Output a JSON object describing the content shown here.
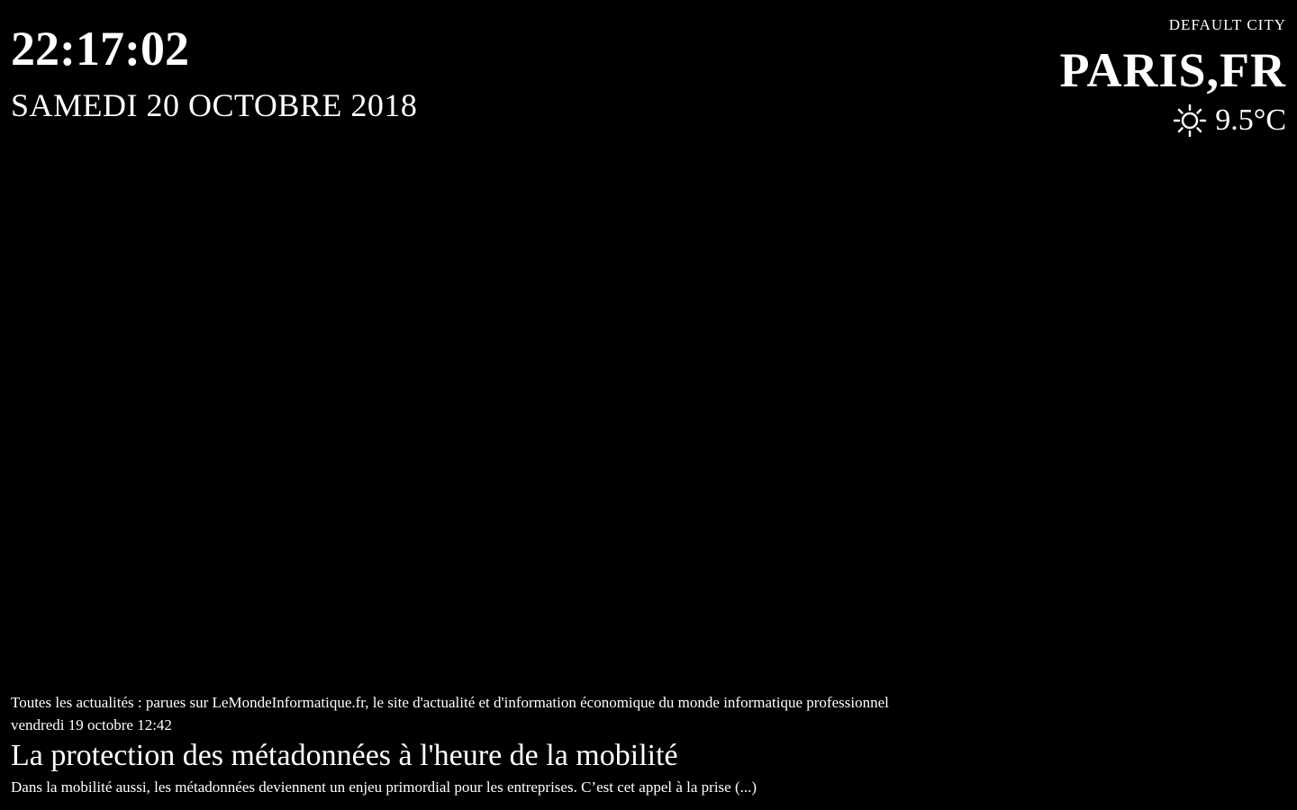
{
  "clock": {
    "time": "22:17:02",
    "date": "samedi 20 octobre 2018"
  },
  "weather": {
    "header": "DEFAULT CITY",
    "city": "PARIS,FR",
    "icon": "sun-icon",
    "temperature": "9.5°C"
  },
  "news": {
    "source": "Toutes les actualités : parues sur LeMondeInformatique.fr, le site d'actualité et d'information économique du monde informatique professionnel",
    "date": "vendredi 19 octobre 12:42",
    "title": "La protection des métadonnées à l'heure de la mobilité",
    "summary": "Dans la mobilité aussi, les métadonnées deviennent un enjeu primordial pour les entreprises. C’est cet appel à la prise (...)"
  },
  "colors": {
    "background": "#000000",
    "text": "#ffffff"
  }
}
